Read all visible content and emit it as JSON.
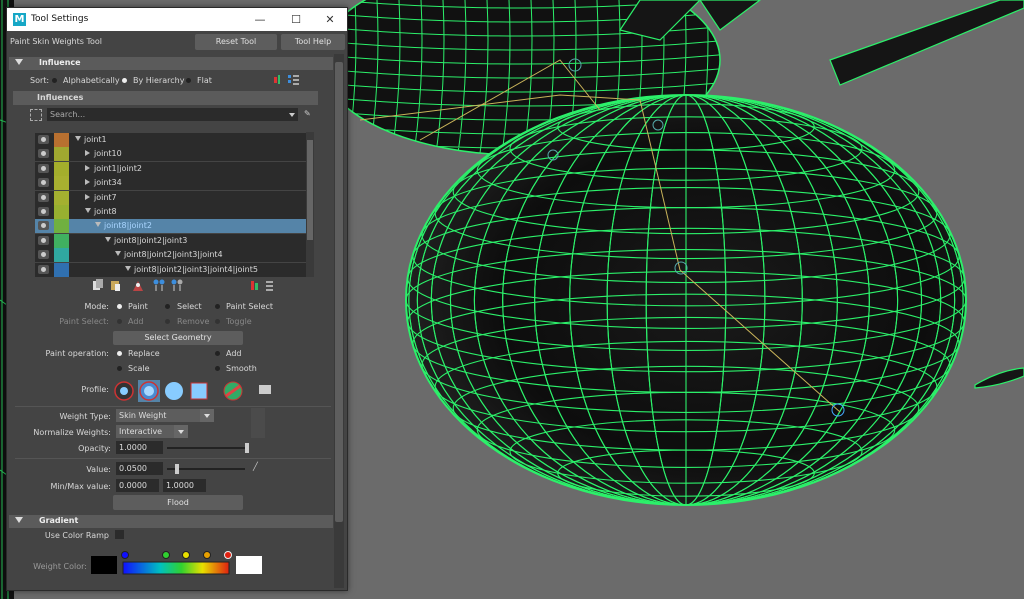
{
  "window": {
    "title": "Tool Settings",
    "logo_letter": "M",
    "minimize": "—",
    "maximize": "☐",
    "close": "✕"
  },
  "toolbar": {
    "tool_name": "Paint Skin Weights Tool",
    "reset_label": "Reset Tool",
    "help_label": "Tool Help"
  },
  "influence": {
    "section_label": "Influence",
    "sort_label": "Sort:",
    "sort_options": [
      "Alphabetically",
      "By Hierarchy",
      "Flat"
    ],
    "sort_selected": "By Hierarchy",
    "subheader": "Influences",
    "search_placeholder": "Search...",
    "joints": [
      {
        "name": "joint1",
        "indent": 0,
        "expanded": true,
        "color": "#b87030",
        "selected": false
      },
      {
        "name": "joint10",
        "indent": 1,
        "expanded": false,
        "color": "#a0a830",
        "selected": false
      },
      {
        "name": "joint1|joint2",
        "indent": 1,
        "expanded": false,
        "color": "#a4ae2c",
        "selected": false
      },
      {
        "name": "joint34",
        "indent": 1,
        "expanded": false,
        "color": "#a8b030",
        "selected": false
      },
      {
        "name": "joint7",
        "indent": 1,
        "expanded": false,
        "color": "#a4b030",
        "selected": false
      },
      {
        "name": "joint8",
        "indent": 1,
        "expanded": true,
        "color": "#98b030",
        "selected": false
      },
      {
        "name": "joint8|joint2",
        "indent": 2,
        "expanded": true,
        "color": "#70b040",
        "selected": true
      },
      {
        "name": "joint8|joint2|joint3",
        "indent": 3,
        "expanded": true,
        "color": "#40b060",
        "selected": false
      },
      {
        "name": "joint8|joint2|joint3|joint4",
        "indent": 4,
        "expanded": true,
        "color": "#30a8a0",
        "selected": false
      },
      {
        "name": "joint8|joint2|joint3|joint4|joint5",
        "indent": 5,
        "expanded": true,
        "color": "#3070b0",
        "selected": false
      }
    ]
  },
  "mode": {
    "label": "Mode:",
    "options": [
      "Paint",
      "Select",
      "Paint Select"
    ],
    "selected": "Paint",
    "paint_select_label": "Paint Select:",
    "paint_select_options": [
      "Add",
      "Remove",
      "Toggle"
    ],
    "select_geometry_label": "Select Geometry"
  },
  "paint_operation": {
    "label": "Paint operation:",
    "options": [
      "Replace",
      "Add",
      "Scale",
      "Smooth"
    ],
    "selected": "Replace"
  },
  "profile": {
    "label": "Profile:"
  },
  "weights": {
    "weight_type_label": "Weight Type:",
    "weight_type_value": "Skin Weight",
    "normalize_label": "Normalize Weights:",
    "normalize_value": "Interactive",
    "opacity_label": "Opacity:",
    "opacity_value": "1.0000",
    "opacity_fraction": 1.0,
    "value_label": "Value:",
    "value_value": "0.0500",
    "value_fraction": 0.05,
    "minmax_label": "Min/Max value:",
    "min_value": "0.0000",
    "max_value": "1.0000",
    "flood_label": "Flood"
  },
  "gradient": {
    "section_label": "Gradient",
    "use_color_ramp_label": "Use Color Ramp",
    "weight_color_label": "Weight Color:"
  },
  "colors": {
    "wire": "#2cf06a",
    "selected_row": "#5584a8",
    "window_bg": "#444444",
    "viewport_bg": "#6b6b6b"
  }
}
